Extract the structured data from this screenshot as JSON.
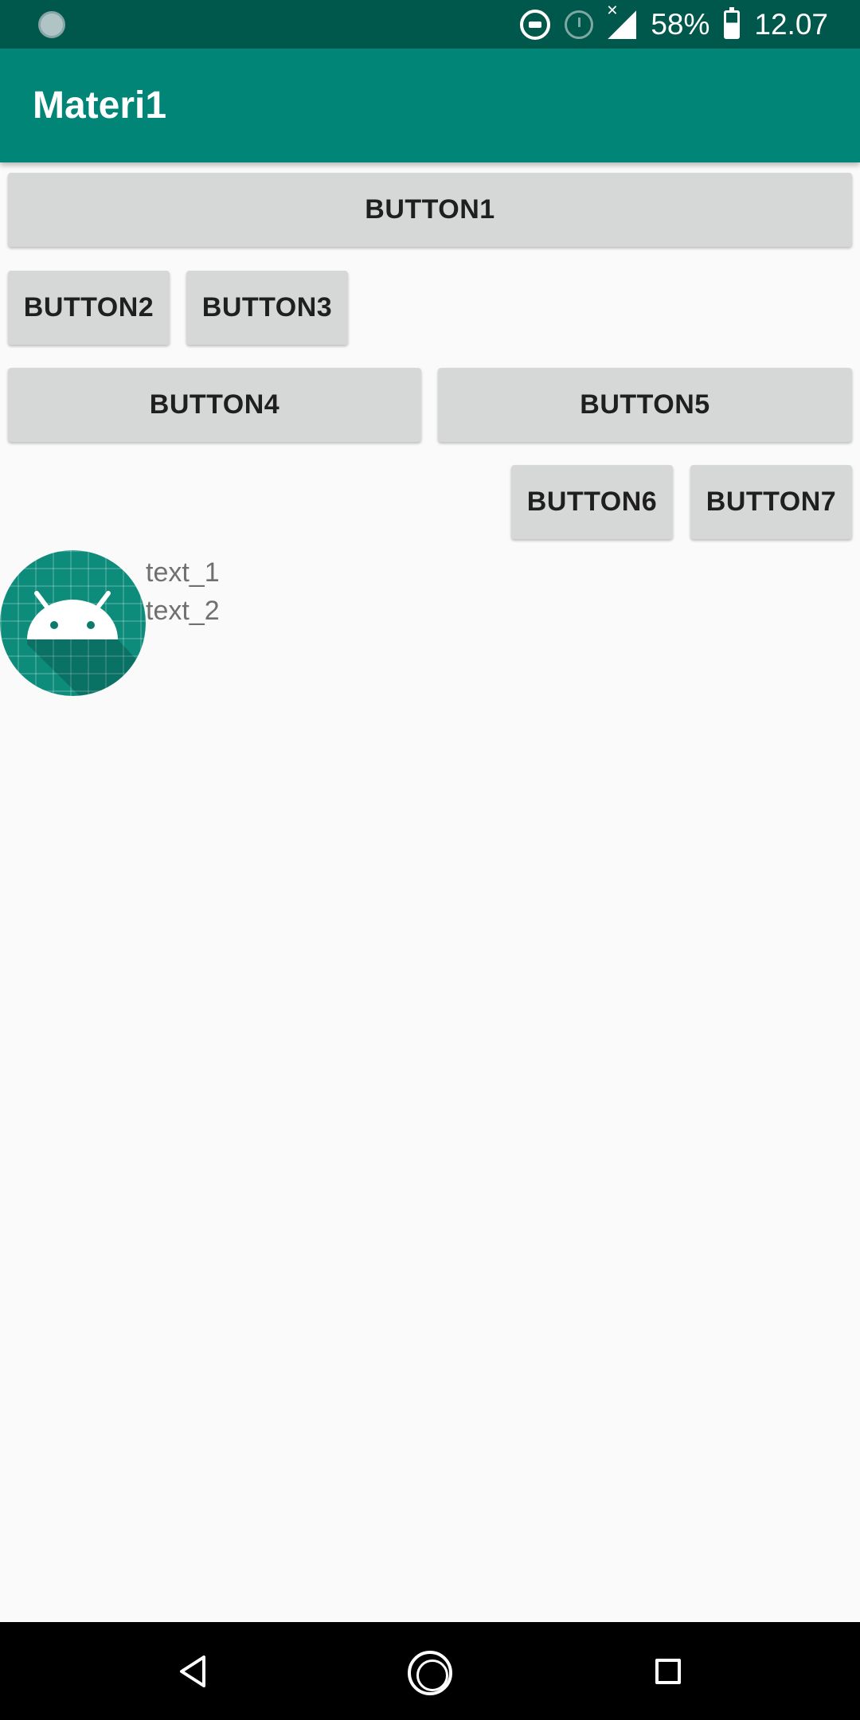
{
  "status_bar": {
    "battery": "58%",
    "time": "12.07",
    "icons": [
      "notification-icon",
      "do-not-disturb-icon",
      "alarm-icon",
      "signal-off-icon",
      "battery-charging-icon"
    ]
  },
  "app_bar": {
    "title": "Materi1"
  },
  "buttons": {
    "b1": "BUTTON1",
    "b2": "BUTTON2",
    "b3": "BUTTON3",
    "b4": "BUTTON4",
    "b5": "BUTTON5",
    "b6": "BUTTON6",
    "b7": "BUTTON7"
  },
  "content": {
    "text_1": "text_1",
    "text_2": "text_2",
    "avatar_icon": "android-icon"
  },
  "nav_bar": {
    "icons": [
      "back-icon",
      "home-icon",
      "recent-apps-icon"
    ]
  },
  "colors": {
    "status_bar": "#00574b",
    "app_bar": "#008577",
    "button_bg": "#d6d7d7",
    "background": "#fafafa"
  }
}
